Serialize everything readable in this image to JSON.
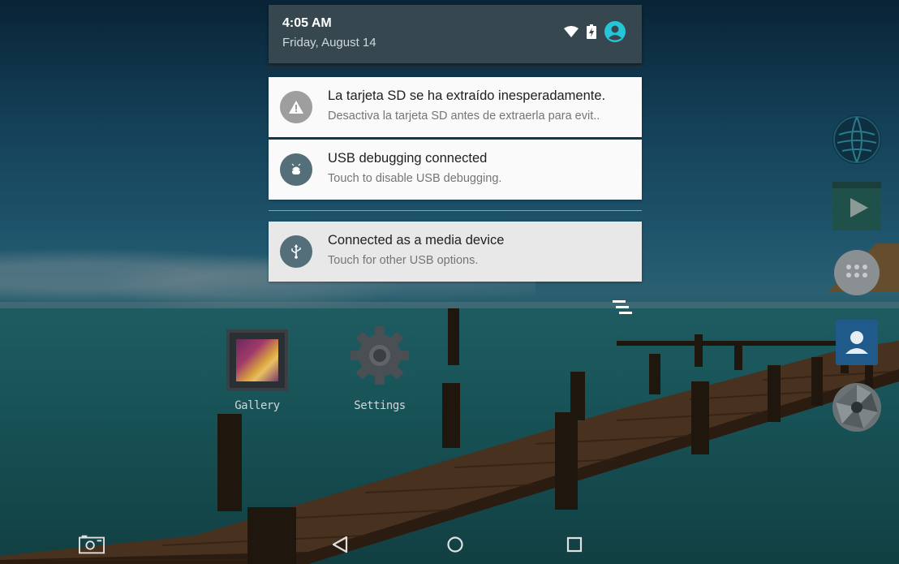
{
  "status": {
    "time": "4:05 AM",
    "date": "Friday, August 14",
    "icons": [
      "wifi-icon",
      "battery-charging-icon",
      "user-avatar-icon"
    ]
  },
  "notifications": [
    {
      "title": "La tarjeta SD se ha extraído inesperadamente.",
      "text": "Desactiva la tarjeta SD antes de extraerla para evit..",
      "icon": "warning-icon",
      "color": "#9e9e9e"
    },
    {
      "title": "USB debugging connected",
      "text": "Touch to disable USB debugging.",
      "icon": "android-bug-icon",
      "color": "#546e7a"
    },
    {
      "title": "Connected as a media device",
      "text": "Touch for other USB options.",
      "icon": "usb-icon",
      "color": "#546e7a"
    }
  ],
  "desktop": {
    "apps": [
      {
        "label": "Gallery",
        "icon": "gallery-icon"
      },
      {
        "label": "Settings",
        "icon": "settings-gear-icon"
      }
    ]
  },
  "dock": [
    "browser-globe-icon",
    "play-store-icon",
    "app-drawer-icon",
    "contacts-icon",
    "camera-icon"
  ],
  "navbar": [
    "screenshot-icon",
    "back-icon",
    "home-icon",
    "recents-icon"
  ],
  "colors": {
    "shade_header": "#37474f",
    "accent": "#26c6da",
    "notification_bg": "#fafafa"
  }
}
